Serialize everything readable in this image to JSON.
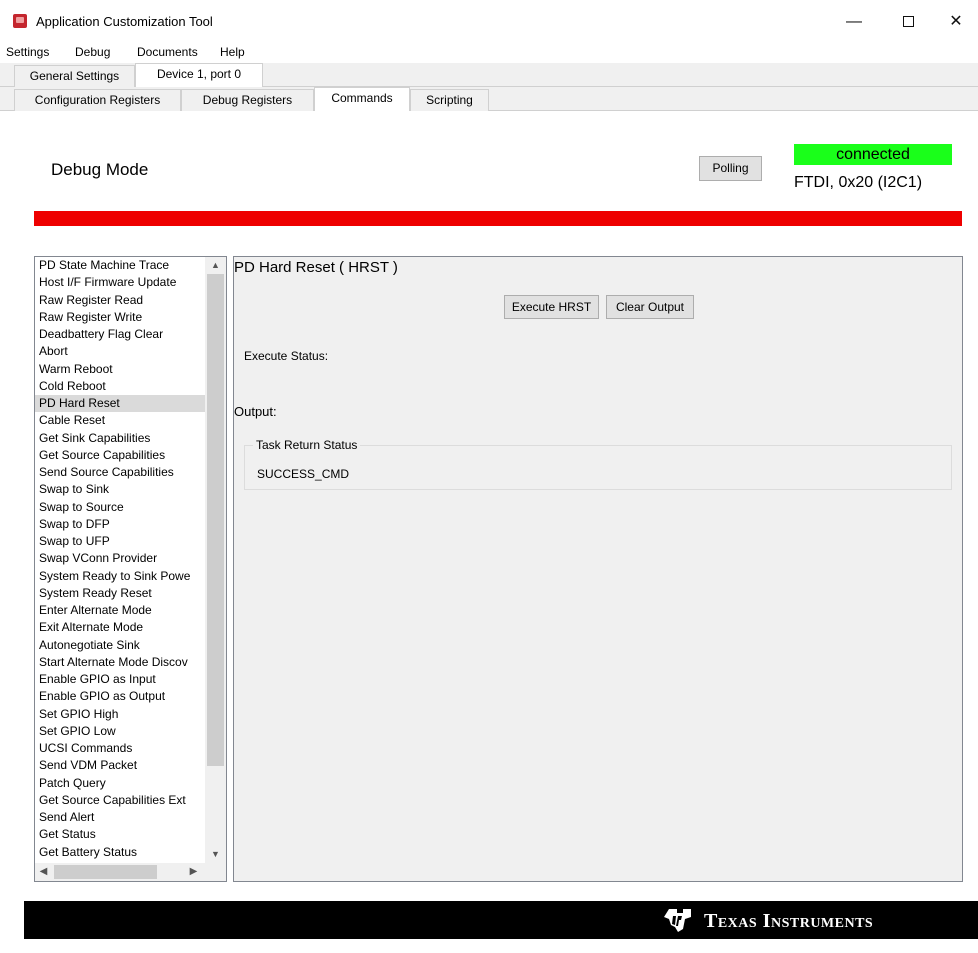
{
  "window": {
    "title": "Application Customization Tool",
    "minimize_glyph": "—",
    "close_glyph": "✕"
  },
  "menu": {
    "items": [
      "Settings",
      "Debug",
      "Documents",
      "Help"
    ]
  },
  "tabs_top": [
    {
      "label": "General Settings",
      "active": false
    },
    {
      "label": "Device 1, port 0",
      "active": true
    }
  ],
  "tabs_sub": [
    {
      "label": "Configuration Registers",
      "active": false
    },
    {
      "label": "Debug Registers",
      "active": false
    },
    {
      "label": "Commands",
      "active": true
    },
    {
      "label": "Scripting",
      "active": false
    }
  ],
  "header": {
    "mode_title": "Debug Mode",
    "polling_label": "Polling",
    "connection_status": "connected",
    "connection_info": "FTDI, 0x20 (I2C1)",
    "status_color": "#1aff1a",
    "alert_bar_color": "#ee0000"
  },
  "command_list": {
    "selected_index": 8,
    "items": [
      "PD State Machine Trace",
      "Host I/F Firmware Update",
      "Raw Register Read",
      "Raw Register Write",
      "Deadbattery Flag Clear",
      "Abort",
      "Warm Reboot",
      "Cold Reboot",
      "PD Hard Reset",
      "Cable Reset",
      "Get Sink Capabilities",
      "Get Source Capabilities",
      "Send Source Capabilities",
      "Swap to Sink",
      "Swap to Source",
      "Swap to DFP",
      "Swap to UFP",
      "Swap VConn Provider",
      "System Ready to Sink Powe",
      "System Ready Reset",
      "Enter Alternate Mode",
      "Exit Alternate Mode",
      "Autonegotiate Sink",
      "Start Alternate Mode Discov",
      "Enable GPIO as Input",
      "Enable GPIO as Output",
      "Set GPIO High",
      "Set GPIO Low",
      "UCSI Commands",
      "Send VDM Packet",
      "Patch Query",
      "Get Source Capabilities Ext",
      "Send Alert",
      "Get Status",
      "Get Battery Status"
    ]
  },
  "scrollbar": {
    "up_glyph": "▲",
    "down_glyph": "▼",
    "left_glyph": "◀",
    "right_glyph": "▶"
  },
  "panel": {
    "command_title": "PD Hard Reset ( HRST )",
    "execute_label": "Execute HRST",
    "clear_label": "Clear Output",
    "execute_status_label": "Execute Status:",
    "output_label": "Output:",
    "group_title": "Task Return Status",
    "group_value": "SUCCESS_CMD"
  },
  "footer": {
    "brand_text": "Texas Instruments",
    "logo_icon": "ti-logo-icon"
  }
}
